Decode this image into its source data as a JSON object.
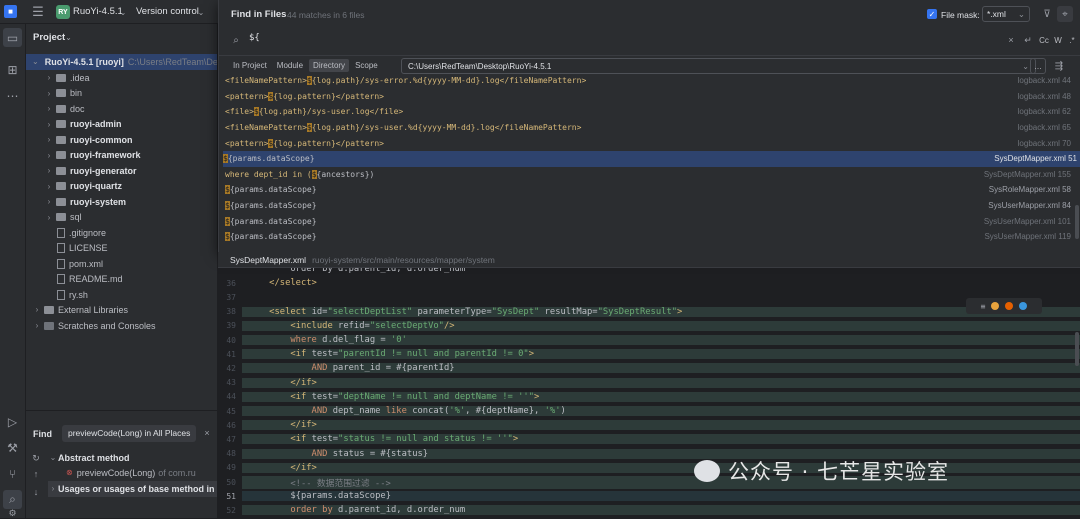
{
  "titlebar": {
    "project_badge": "RY",
    "project_name": "RuoYi-4.5.1",
    "vcs": "Version control"
  },
  "project_panel": {
    "title": "Project",
    "root_label": "RuoYi-4.5.1 [ruoyi]",
    "root_path": "C:\\Users\\RedTeam\\De",
    "items": [
      {
        "label": ".idea",
        "type": "folder",
        "bold": false
      },
      {
        "label": "bin",
        "type": "folder",
        "bold": false
      },
      {
        "label": "doc",
        "type": "folder",
        "bold": false
      },
      {
        "label": "ruoyi-admin",
        "type": "folder",
        "bold": true
      },
      {
        "label": "ruoyi-common",
        "type": "folder",
        "bold": true
      },
      {
        "label": "ruoyi-framework",
        "type": "folder",
        "bold": true
      },
      {
        "label": "ruoyi-generator",
        "type": "folder",
        "bold": true
      },
      {
        "label": "ruoyi-quartz",
        "type": "folder",
        "bold": true
      },
      {
        "label": "ruoyi-system",
        "type": "folder",
        "bold": true
      },
      {
        "label": "sql",
        "type": "folder",
        "bold": false
      },
      {
        "label": ".gitignore",
        "type": "file",
        "bold": false
      },
      {
        "label": "LICENSE",
        "type": "file",
        "bold": false
      },
      {
        "label": "pom.xml",
        "type": "file",
        "bold": false
      },
      {
        "label": "README.md",
        "type": "file",
        "bold": false
      },
      {
        "label": "ry.sh",
        "type": "file",
        "bold": false
      }
    ],
    "external": "External Libraries",
    "scratches": "Scratches and Consoles"
  },
  "find_panel": {
    "tab_find": "Find",
    "tab_query": "previewCode(Long) in All Places",
    "group": "Abstract method",
    "item": "previewCode(Long)",
    "item_suffix": "of com.ru",
    "usages": "Usages or usages of base method in"
  },
  "popup": {
    "title": "Find in Files",
    "summary": "44 matches in 6 files",
    "file_mask_label": "File mask:",
    "file_mask_value": "*.xml",
    "query": "${",
    "scopes": [
      "In Project",
      "Module",
      "Directory",
      "Scope"
    ],
    "active_scope": "Directory",
    "path": "C:\\Users\\RedTeam\\Desktop\\RuoYi-4.5.1",
    "opt_case": "Cc",
    "opt_word": "W",
    "opt_regex": ".*",
    "results": [
      {
        "pre": "<fileNamePattern>",
        "match": "$",
        "post": "{log.path}/sys-error.%d{yyyy-MM-dd}.log</fileNamePattern>",
        "file": "logback.xml 44",
        "dim": true
      },
      {
        "pre": "<pattern>",
        "match": "$",
        "post": "{log.pattern}</pattern>",
        "file": "logback.xml 48",
        "dim": true
      },
      {
        "pre": "<file>",
        "match": "$",
        "post": "{log.path}/sys-user.log</file>",
        "file": "logback.xml 62",
        "dim": true
      },
      {
        "pre": "<fileNamePattern>",
        "match": "$",
        "post": "{log.path}/sys-user.%d{yyyy-MM-dd}.log</fileNamePattern>",
        "file": "logback.xml 65",
        "dim": true
      },
      {
        "pre": "<pattern>",
        "match": "$",
        "post": "{log.pattern}</pattern>",
        "file": "logback.xml 70",
        "dim": true
      },
      {
        "pre": "",
        "match": "$",
        "post": "{params.dataScope}",
        "file": "SysDeptMapper.xml 51",
        "dim": false,
        "selected": true
      },
      {
        "pre": "where dept_id in (",
        "match": "$",
        "post": "{ancestors})",
        "file": "SysDeptMapper.xml 155",
        "dim": true
      },
      {
        "pre": "",
        "match": "$",
        "post": "{params.dataScope}",
        "file": "SysRoleMapper.xml 58",
        "dim": false
      },
      {
        "pre": "",
        "match": "$",
        "post": "{params.dataScope}",
        "file": "SysUserMapper.xml 84",
        "dim": false
      },
      {
        "pre": "",
        "match": "$",
        "post": "{params.dataScope}",
        "file": "SysUserMapper.xml 101",
        "dim": true
      },
      {
        "pre": "",
        "match": "$",
        "post": "{params.dataScope}",
        "file": "SysUserMapper.xml 119",
        "dim": true
      }
    ],
    "preview_file": "SysDeptMapper.xml",
    "preview_path": "ruoyi-system/src/main/resources/mapper/system"
  },
  "editor": {
    "lines": [
      {
        "n": "",
        "html": "<span class='a'>        order by d.parent_id, d.order_num</span>"
      },
      {
        "n": "36",
        "html": "<span class='t'>    &lt;/select&gt;</span>"
      },
      {
        "n": "37",
        "html": ""
      },
      {
        "n": "38",
        "html": "<span class='t'>    &lt;select </span><span class='a'>id=</span><span class='s'>\"selectDeptList\"</span><span class='a'> parameterType=</span><span class='s'>\"SysDept\"</span><span class='a'> resultMap=</span><span class='s'>\"SysDeptResult\"</span><span class='t'>&gt;</span>"
      },
      {
        "n": "39",
        "html": "<span class='t'>        &lt;include </span><span class='a'>refid=</span><span class='s'>\"selectDeptVo\"</span><span class='t'>/&gt;</span>"
      },
      {
        "n": "40",
        "html": "<span class='k'>        where </span><span class='a'>d.del_flag = </span><span class='s'>'0'</span>"
      },
      {
        "n": "41",
        "html": "<span class='t'>        &lt;if </span><span class='a'>test=</span><span class='s'>\"parentId != null and parentId != 0\"</span><span class='t'>&gt;</span>"
      },
      {
        "n": "42",
        "html": "<span class='k'>            AND </span><span class='a'>parent_id = #{parentId}</span>"
      },
      {
        "n": "43",
        "html": "<span class='t'>        &lt;/if&gt;</span>"
      },
      {
        "n": "44",
        "html": "<span class='t'>        &lt;if </span><span class='a'>test=</span><span class='s'>\"deptName != null and deptName != ''\"</span><span class='t'>&gt;</span>"
      },
      {
        "n": "45",
        "html": "<span class='k'>            AND </span><span class='a'>dept_name </span><span class='k'>like </span><span class='a'>concat(</span><span class='s'>'%'</span><span class='a'>, #{deptName}, </span><span class='s'>'%'</span><span class='a'>)</span>"
      },
      {
        "n": "46",
        "html": "<span class='t'>        &lt;/if&gt;</span>"
      },
      {
        "n": "47",
        "html": "<span class='t'>        &lt;if </span><span class='a'>test=</span><span class='s'>\"status != null and status != ''\"</span><span class='t'>&gt;</span>"
      },
      {
        "n": "48",
        "html": "<span class='k'>            AND </span><span class='a'>status = #{status}</span>"
      },
      {
        "n": "49",
        "html": "<span class='t'>        &lt;/if&gt;</span>"
      },
      {
        "n": "50",
        "html": "<span class='c'>        &lt;!-- 数据范围过滤 --&gt;</span>"
      },
      {
        "n": "51",
        "html": "<span class='a'>        ${params.dataScope}</span>"
      },
      {
        "n": "52",
        "html": "<span class='k'>        order by </span><span class='a'>d.parent_id, d.order_num</span>"
      }
    ]
  },
  "watermark": "公众号 · 七芒星实验室"
}
